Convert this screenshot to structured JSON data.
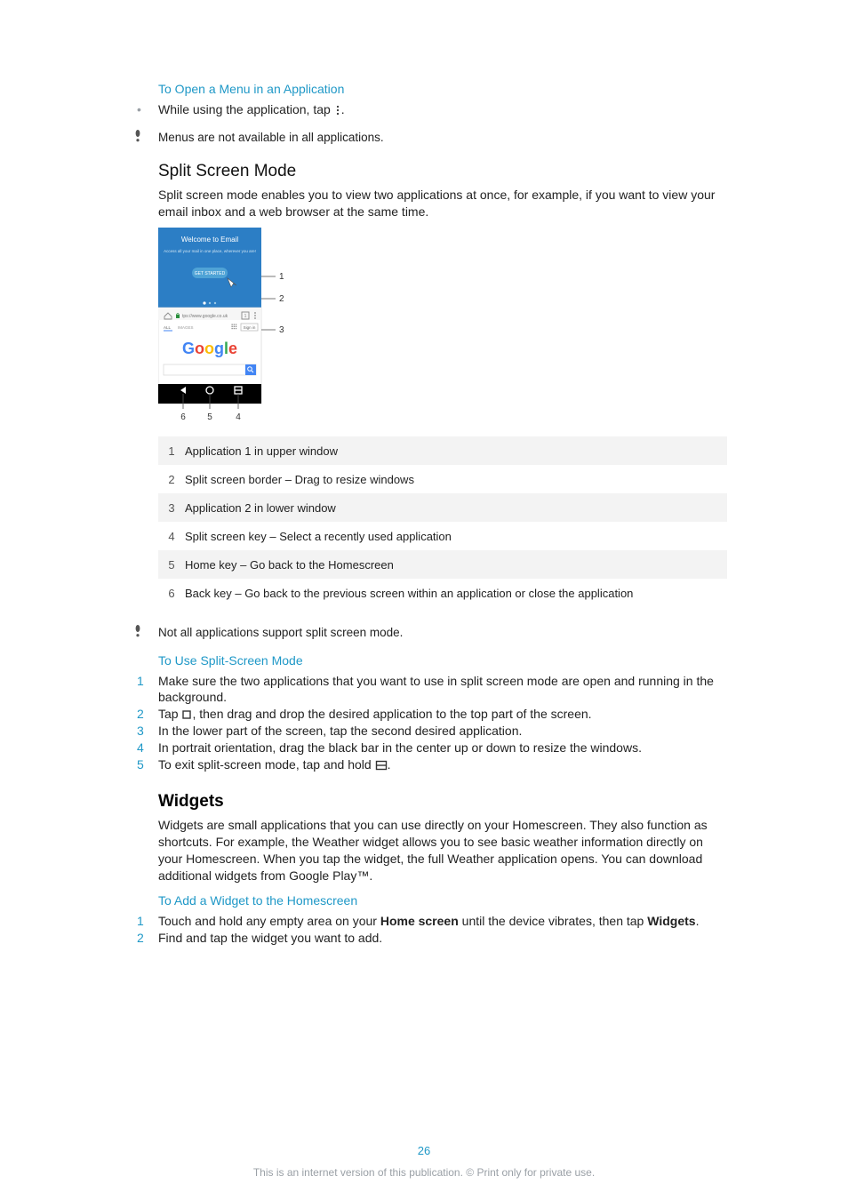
{
  "sec_open_menu": {
    "title": "To Open a Menu in an Application",
    "bullet_pre": "While using the application, tap ",
    "bullet_post": "."
  },
  "note_menus": "Menus are not available in all applications.",
  "split_screen": {
    "title": "Split Screen Mode",
    "para": "Split screen mode enables you to view two applications at once, for example, if you want to view your email inbox and a web browser at the same time."
  },
  "illus": {
    "email_title": "Welcome to Email",
    "email_sub": "Access all your mail in one place, wherever you are!",
    "get_started": "GET STARTED",
    "url": "tps://www.google.co.uk",
    "all": "ALL",
    "images": "IMAGES",
    "signin": "Sign in",
    "logo": {
      "g1": "G",
      "o1": "o",
      "o2": "o",
      "g2": "g",
      "l": "l",
      "e": "e"
    },
    "label_1": "1",
    "label_2": "2",
    "label_3": "3",
    "label_4": "4",
    "label_5": "5",
    "label_6": "6"
  },
  "callouts": [
    {
      "n": "1",
      "d": "Application 1 in upper window"
    },
    {
      "n": "2",
      "d": "Split screen border – Drag to resize windows"
    },
    {
      "n": "3",
      "d": "Application 2 in lower window"
    },
    {
      "n": "4",
      "d": "Split screen key – Select a recently used application"
    },
    {
      "n": "5",
      "d": "Home key – Go back to the Homescreen"
    },
    {
      "n": "6",
      "d": "Back key – Go back to the previous screen within an application or close the application"
    }
  ],
  "note_split": "Not all applications support split screen mode.",
  "use_split": {
    "title": "To Use Split-Screen Mode",
    "s1": "Make sure the two applications that you want to use in split screen mode are open and running in the background.",
    "s2a": "Tap ",
    "s2b": ", then drag and drop the desired application to the top part of the screen.",
    "s3": "In the lower part of the screen, tap the second desired application.",
    "s4": "In portrait orientation, drag the black bar in the center up or down to resize the windows.",
    "s5a": "To exit split-screen mode, tap and hold ",
    "s5b": "."
  },
  "widgets": {
    "title": "Widgets",
    "para": "Widgets are small applications that you can use directly on your Homescreen. They also function as shortcuts. For example, the Weather widget allows you to see basic weather information directly on your Homescreen. When you tap the widget, the full Weather application opens. You can download additional widgets from Google Play™."
  },
  "add_widget": {
    "title": "To Add a Widget to the Homescreen",
    "s1a": "Touch and hold any empty area on your ",
    "s1b": "Home screen",
    "s1c": " until the device vibrates, then tap ",
    "s1d": "Widgets",
    "s1e": ".",
    "s2": "Find and tap the widget you want to add."
  },
  "page_number": "26",
  "footer": "This is an internet version of this publication. © Print only for private use."
}
